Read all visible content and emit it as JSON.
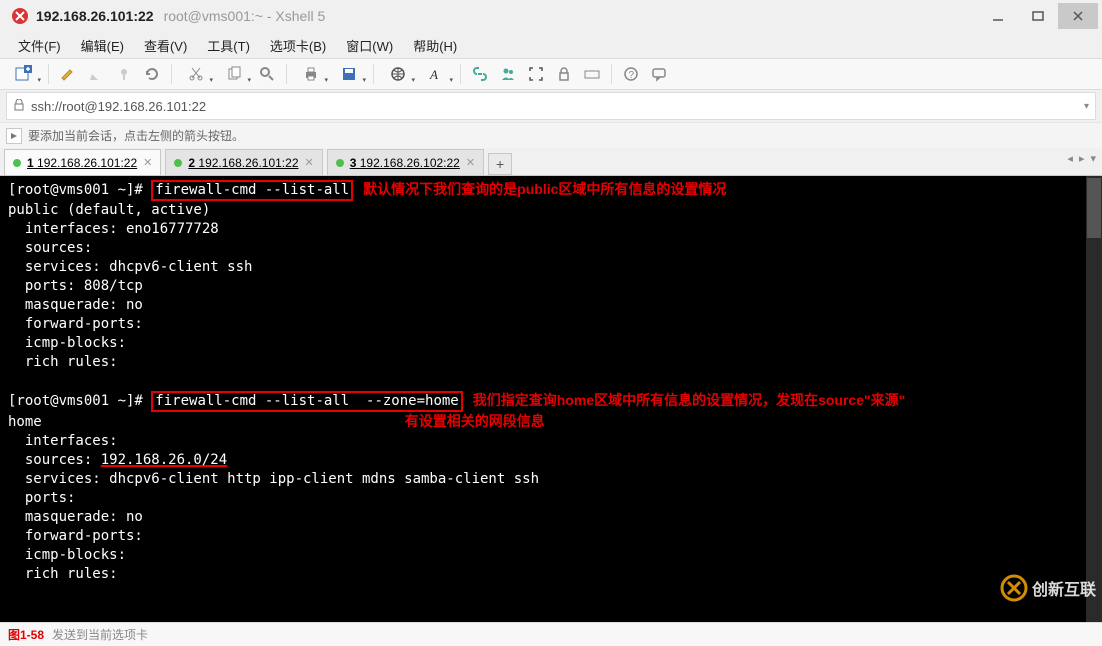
{
  "titlebar": {
    "active_title": "192.168.26.101:22",
    "sub_title": "root@vms001:~ - Xshell 5"
  },
  "menubar": {
    "items": [
      "文件(F)",
      "编辑(E)",
      "查看(V)",
      "工具(T)",
      "选项卡(B)",
      "窗口(W)",
      "帮助(H)"
    ]
  },
  "toolbar": {
    "icons": [
      "new-session-icon",
      "dropdown",
      "sep",
      "edit-icon",
      "pencil-icon",
      "pin-icon",
      "refresh-icon",
      "sep",
      "scissors-icon",
      "dropdown",
      "copy-icon",
      "dropdown",
      "search-icon",
      "sep",
      "print-icon",
      "dropdown",
      "save-icon",
      "dropdown",
      "sep",
      "globe-icon",
      "dropdown",
      "font-icon",
      "dropdown",
      "sep",
      "link-icon",
      "people-icon",
      "fullscreen-icon",
      "lock-icon",
      "keyboard-icon",
      "sep",
      "help-icon",
      "chat-icon"
    ]
  },
  "addressbar": {
    "lock_label": "🔒",
    "url": "ssh://root@192.168.26.101:22"
  },
  "hintbar": {
    "icon": "➜",
    "text": "要添加当前会话，点击左侧的箭头按钮。"
  },
  "tabs": [
    {
      "index": "1",
      "label": "192.168.26.101:22",
      "active": true
    },
    {
      "index": "2",
      "label": "192.168.26.101:22",
      "active": false
    },
    {
      "index": "3",
      "label": "192.168.26.102:22",
      "active": false
    }
  ],
  "terminal": {
    "prompt1_prefix": "[root@vms001 ~]# ",
    "cmd1": "firewall-cmd --list-all",
    "note1": "默认情况下我们查询的是public区域中所有信息的设置情况",
    "out1_l1": "public (default, active)",
    "out1_l2": "  interfaces: eno16777728",
    "out1_l3": "  sources:",
    "out1_l4": "  services: dhcpv6-client ssh",
    "out1_l5": "  ports: 808/tcp",
    "out1_l6": "  masquerade: no",
    "out1_l7": "  forward-ports:",
    "out1_l8": "  icmp-blocks:",
    "out1_l9": "  rich rules:",
    "blank": "",
    "prompt2_prefix": "[root@vms001 ~]# ",
    "cmd2": "firewall-cmd --list-all  --zone=home",
    "note2a": "我们指定查询home区域中所有信息的设置情况，发现在source\"来源\"",
    "note2b": "有设置相关的网段信息",
    "out2_l1": "home",
    "out2_l2": "  interfaces:",
    "out2_l3_lead": "  sources: ",
    "out2_l3_val": "192.168.26.0/24",
    "out2_l4": "  services: dhcpv6-client http ipp-client mdns samba-client ssh",
    "out2_l5": "  ports:",
    "out2_l6": "  masquerade: no",
    "out2_l7": "  forward-ports:",
    "out2_l8": "  icmp-blocks:",
    "out2_l9": "  rich rules:",
    "out2_l10": ""
  },
  "statusbar": {
    "fig_label": "图1-58",
    "hint": "发送到当前选项卡"
  },
  "watermark": {
    "text": "创新互联"
  }
}
